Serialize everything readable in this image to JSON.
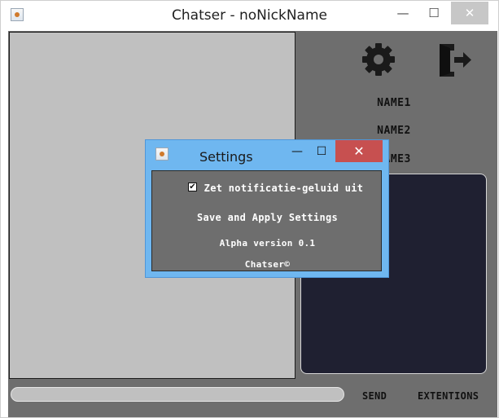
{
  "window": {
    "title": "Chatser - noNickName",
    "controls": {
      "minimize": "—",
      "maximize": "☐",
      "close": "✕"
    }
  },
  "right_panel": {
    "icons": [
      "gear-icon",
      "exit-icon"
    ],
    "names": [
      "NAME1",
      "NAME2",
      "NAME3"
    ]
  },
  "bottom": {
    "send_label": "SEND",
    "extentions_label": "EXTENTIONS"
  },
  "settings_dialog": {
    "title": "Settings",
    "controls": {
      "minimize": "—",
      "maximize": "☐",
      "close": "✕"
    },
    "checkbox_checked": true,
    "checkbox_label": "Zet notificatie-geluid uit",
    "apply_label": "Save and Apply Settings",
    "version_text": "Alpha version 0.1",
    "brand_text": "Chatser©"
  },
  "colors": {
    "panel_gray": "#6e6e6e",
    "chat_gray": "#c0c0c0",
    "dark_panel": "#1f2031",
    "dialog_frame": "#6fb7f0",
    "close_red": "#c75050"
  }
}
